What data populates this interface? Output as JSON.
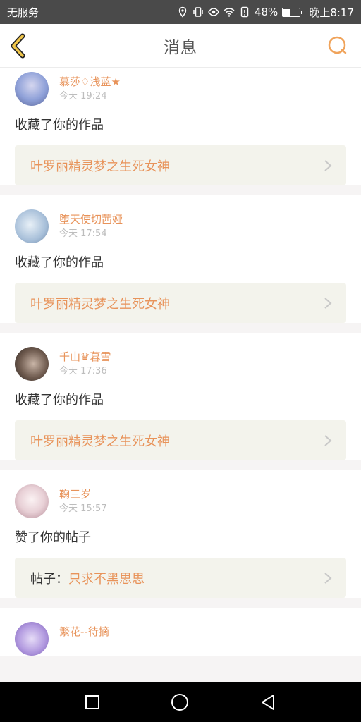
{
  "status_bar": {
    "carrier": "无服务",
    "battery": "48%",
    "battery_fraction": 0.48,
    "time": "晚上8:17"
  },
  "header": {
    "title": "消息"
  },
  "messages": [
    {
      "name": "慕莎♢浅蓝★",
      "time": "今天 19:24",
      "action": "收藏了你的作品",
      "prefix": "",
      "title": "叶罗丽精灵梦之生死女神",
      "avatar_color": "#8ea0d8"
    },
    {
      "name": "堕天使切茜娅",
      "time": "今天 17:54",
      "action": "收藏了你的作品",
      "prefix": "",
      "title": "叶罗丽精灵梦之生死女神",
      "avatar_color": "#a7bfd9"
    },
    {
      "name": "千山♛暮雪",
      "time": "今天 17:36",
      "action": "收藏了你的作品",
      "prefix": "",
      "title": "叶罗丽精灵梦之生死女神",
      "avatar_color": "#6e5a4e"
    },
    {
      "name": "鞠三岁",
      "time": "今天 15:57",
      "action": "赞了你的帖子",
      "prefix": "帖子：",
      "title": "只求不黑思思",
      "avatar_color": "#d9b9c2"
    },
    {
      "name": "繁花--待摘",
      "time": "",
      "action": "",
      "prefix": "",
      "title": "",
      "avatar_color": "#b39be0"
    }
  ]
}
